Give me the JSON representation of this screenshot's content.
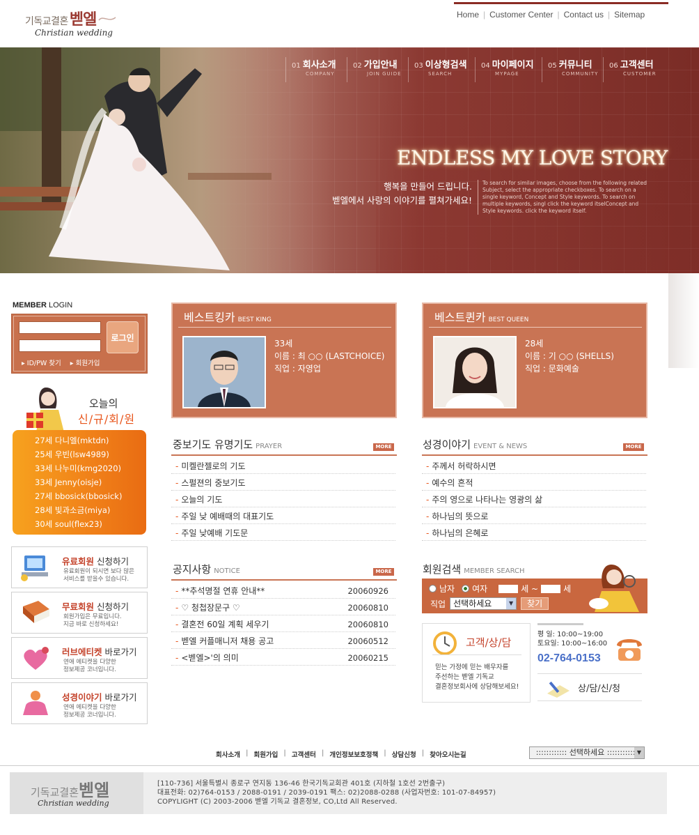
{
  "logo": {
    "small": "기독교결혼",
    "big": "벧엘",
    "sub": "Christian wedding"
  },
  "top_nav": [
    "Home",
    "Customer Center",
    "Contact us",
    "Sitemap"
  ],
  "main_nav": [
    {
      "num": "01",
      "ko": "회사소개",
      "en": "COMPANY"
    },
    {
      "num": "02",
      "ko": "가입안내",
      "en": "JOIN GUIDE"
    },
    {
      "num": "03",
      "ko": "이상형검색",
      "en": "SEARCH"
    },
    {
      "num": "04",
      "ko": "마이페이지",
      "en": "MYPAGE"
    },
    {
      "num": "05",
      "ko": "커뮤니티",
      "en": "COMMUNITY"
    },
    {
      "num": "06",
      "ko": "고객센터",
      "en": "CUSTOMER"
    }
  ],
  "hero": {
    "title": "ENDLESS MY LOVE STORY",
    "ko_line1": "행복을 만들어 드립니다.",
    "ko_line2": "벧엘에서 사랑의 이야기를 펼쳐가세요!",
    "en_text": "To search for similar images, choose from the following related Subject, select the appropriate checkboxes. To search on a single keyword, Concept and Style keywords. To search on multiple keywords, singl click the keyword itselConcept and Style keywords. click the keyword itself."
  },
  "login": {
    "title_bold": "MEMBER",
    "title_rest": " LOGIN",
    "button": "로그인",
    "link_find": "ID/PW 찾기",
    "link_join": "회원가입"
  },
  "new_members": {
    "label1": "오늘의",
    "label2": "신/규/회/원",
    "list": [
      "27세 다니엘(mktdn)",
      "25세 우빈(lsw4989)",
      "33세 나누미(kmg2020)",
      "33세 Jenny(oisje)",
      "27세 bbosick(bbosick)",
      "28세 빛과소금(miya)",
      "30세 soul(flex23)"
    ]
  },
  "banners": [
    {
      "strong": "유료회원",
      "rest": " 신청하기",
      "desc1": "유료회원이 되시면 보다 많은",
      "desc2": "서비스를 받을수 있습니다."
    },
    {
      "strong": "무료회원",
      "rest": " 신청하기",
      "desc1": "회원가입은 무료입니다.",
      "desc2": "지금 바로 신청하세요!"
    },
    {
      "strong": "러브에티켓",
      "rest": " 바로가기",
      "desc1": "연애 에티켓을 다양한",
      "desc2": "정보제공 코너입니다."
    },
    {
      "strong": "성경이야기",
      "rest": " 바로가기",
      "desc1": "연애 에티켓을 다양한",
      "desc2": "정보제공 코너입니다."
    }
  ],
  "best_king": {
    "title": "베스트킹카",
    "en": "BEST KING",
    "age": "33세",
    "name": "이름 : 최 ○○ (LASTCHOICE)",
    "job": "직업 : 자영업"
  },
  "best_queen": {
    "title": "베스트퀸카",
    "en": "BEST QUEEN",
    "age": "28세",
    "name": "이름 : 기 ○○ (SHELLS)",
    "job": "직업 : 문화예술"
  },
  "more_label": "MORE",
  "prayer": {
    "title": "중보기도 유명기도",
    "en": "PRAYER",
    "items": [
      "미켈란젤로의 기도",
      "스펄젼의 중보기도",
      "오늘의 기도",
      "주일 낮 예배때의 대표기도",
      "주일 낮예배 기도문"
    ]
  },
  "bible": {
    "title": "성경이야기",
    "en": "EVENT & NEWS",
    "items": [
      "주께서 허락하시면",
      "예수의 흔적",
      "주의 영으로 나타나는 영광의 삶",
      "하나님의 뜻으로",
      "하나님의 은혜로"
    ]
  },
  "notice": {
    "title": "공지사항",
    "en": "NOTICE",
    "items": [
      {
        "text": "**추석명절 연휴 안내**",
        "date": "20060926"
      },
      {
        "text": "♡ 청첩장문구 ♡",
        "date": "20060810"
      },
      {
        "text": "결혼전 60일 계획 세우기",
        "date": "20060810"
      },
      {
        "text": "벧엘 커플매니저 채용 공고",
        "date": "20060512"
      },
      {
        "text": "<벧엘>'의 의미",
        "date": "20060215"
      }
    ]
  },
  "member_search": {
    "title": "회원검색",
    "en": "MEMBER SEARCH",
    "male": "남자",
    "female": "여자",
    "age_sep": "세 ~",
    "age_end": "세",
    "job_label": "직업",
    "select_value": "선택하세요",
    "button": "찾기"
  },
  "customer": {
    "title": "고객/상/담",
    "desc1": "믿는 가정에 믿는 배우자를",
    "desc2": "주선하는 벧엘 기독교",
    "desc3": "결혼정보회사에 상담해보세요!",
    "weekday": "평    일: 10:00~19:00",
    "saturday": "토요일: 10:00~16:00",
    "phone": "02-764-0153",
    "apply": "상/담/신/청"
  },
  "footer_nav": [
    "회사소개",
    "회원가입",
    "고객센터",
    "개인정보보호정책",
    "상담신청",
    "찾아오시는길"
  ],
  "footer_select": ":::::::::::: 선택하세요 ::::::::::::",
  "footer": {
    "addr1": "[110-736] 서울특별시 종로구 연지동 136-46 한국기독교회관 401호 (지하철 1호선 2번출구)",
    "addr2": "대표전화: 02)764-0153 / 2088-0191 / 2039-0191  팩스: 02)2088-0288 (사업자번호: 101-07-84957)",
    "addr3": "COPYLIGHT (C) 2003-2006 벧엘 기독교 결혼정보, CO,Ltd All Reserved."
  },
  "colors": {
    "accent": "#c97454",
    "brand_dark": "#8a2b24",
    "orange": "#e8541a"
  }
}
